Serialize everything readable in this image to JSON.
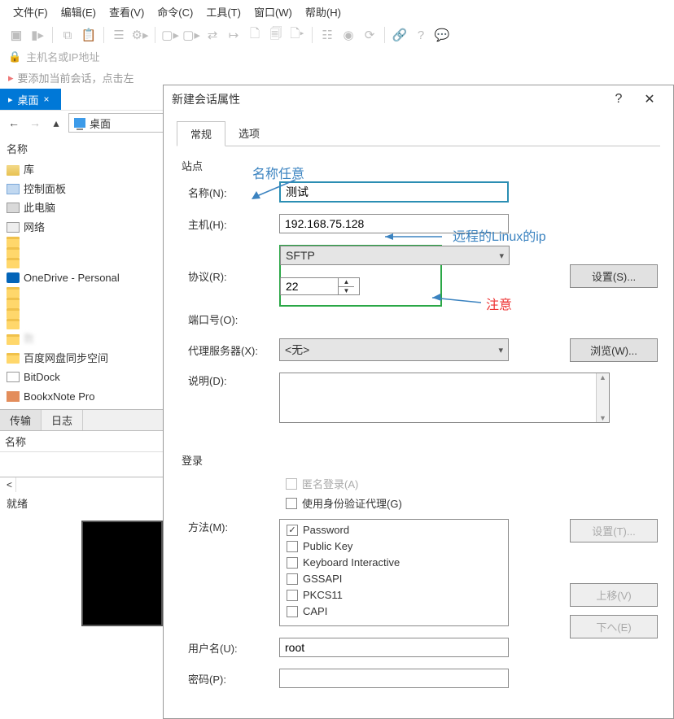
{
  "menu": [
    "文件(F)",
    "编辑(E)",
    "查看(V)",
    "命令(C)",
    "工具(T)",
    "窗口(W)",
    "帮助(H)"
  ],
  "address_placeholder": "主机名或IP地址",
  "session_hint": "要添加当前会话，点击左",
  "desktop_tab": "桌面",
  "tab_close": "×",
  "path_label": "桌面",
  "tree_header": "名称",
  "tree_items": [
    {
      "icon": "fi-lib",
      "label": "库"
    },
    {
      "icon": "fi-ctrl",
      "label": "控制面板"
    },
    {
      "icon": "fi-pc",
      "label": "此电脑"
    },
    {
      "icon": "fi-net",
      "label": "网络"
    },
    {
      "icon": "fi-folder",
      "label": " ",
      "blur": true
    },
    {
      "icon": "fi-folder",
      "label": " ",
      "blur": true
    },
    {
      "icon": "fi-folder",
      "label": " ",
      "blur": true
    },
    {
      "icon": "fi-od",
      "label": "OneDrive - Personal"
    },
    {
      "icon": "fi-folder",
      "label": " ",
      "blur": true
    },
    {
      "icon": "fi-folder",
      "label": " ",
      "blur": true
    },
    {
      "icon": "fi-folder",
      "label": " ",
      "blur": true
    },
    {
      "icon": "fi-folder",
      "label": " ",
      "blur": true
    },
    {
      "icon": "fi-folder",
      "label": "数",
      "blur": true
    },
    {
      "icon": "fi-folder",
      "label": "百度网盘同步空间"
    },
    {
      "icon": "fi-bd",
      "label": "BitDock"
    },
    {
      "icon": "fi-bxn",
      "label": "BookxNote Pro"
    }
  ],
  "bottom_tabs": {
    "transfer": "传输",
    "log": "日志"
  },
  "col_name": "名称",
  "status_row": "<",
  "ready": "就绪",
  "dialog": {
    "title": "新建会话属性",
    "tabs": {
      "general": "常规",
      "options": "选项"
    },
    "site_section": "站点",
    "name_label": "名称(N):",
    "name_value": "测试",
    "host_label": "主机(H):",
    "host_value": "192.168.75.128",
    "protocol_label": "协议(R):",
    "protocol_value": "SFTP",
    "settings_btn": "设置(S)...",
    "port_label": "端口号(O):",
    "port_value": "22",
    "proxy_label": "代理服务器(X):",
    "proxy_value": "<无>",
    "browse_btn": "浏览(W)...",
    "desc_label": "说明(D):",
    "login_section": "登录",
    "anon_login": "匿名登录(A)",
    "use_agent": "使用身份验证代理(G)",
    "method_label": "方法(M):",
    "methods": [
      {
        "label": "Password",
        "checked": true
      },
      {
        "label": "Public Key",
        "checked": false
      },
      {
        "label": "Keyboard Interactive",
        "checked": false
      },
      {
        "label": "GSSAPI",
        "checked": false
      },
      {
        "label": "PKCS11",
        "checked": false
      },
      {
        "label": "CAPI",
        "checked": false
      }
    ],
    "setup_btn": "设置(T)...",
    "up_btn": "上移(V)",
    "down_btn": "下へ(E)",
    "username_label": "用户名(U):",
    "username_value": "root",
    "password_label": "密码(P):"
  },
  "annotations": {
    "name_note": "名称任意",
    "ip_note": "远程的Linux的ip",
    "port_note": "注意"
  }
}
